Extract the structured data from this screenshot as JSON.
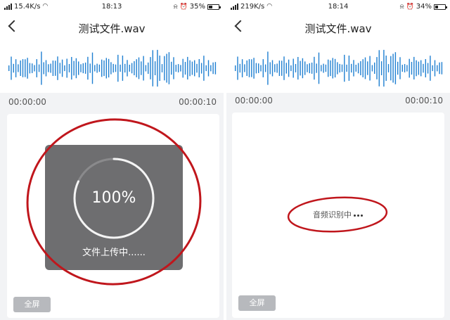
{
  "left": {
    "status": {
      "network": "15.4K/s",
      "time": "18:13",
      "battery": "35%",
      "battery_level": 0.35
    },
    "title": "测试文件.wav",
    "time_start": "00:00:00",
    "time_end": "00:00:10",
    "upload": {
      "percent": "100%",
      "status": "文件上传中......",
      "progress": 1.0
    },
    "fullscreen_label": "全屏"
  },
  "right": {
    "status": {
      "network": "219K/s",
      "time": "18:14",
      "battery": "34%",
      "battery_level": 0.34
    },
    "title": "测试文件.wav",
    "time_start": "00:00:00",
    "time_end": "00:00:10",
    "recognizing": "音频识别中",
    "fullscreen_label": "全屏"
  },
  "colors": {
    "waveform": "#1f7fd1",
    "annotation": "#c0161c",
    "overlay": "#6e6e70",
    "button": "#b7b9bd"
  },
  "icons": [
    "signal-icon",
    "wifi-icon",
    "mute-icon",
    "alarm-icon",
    "battery-icon",
    "back-icon",
    "loading-dots-icon"
  ]
}
